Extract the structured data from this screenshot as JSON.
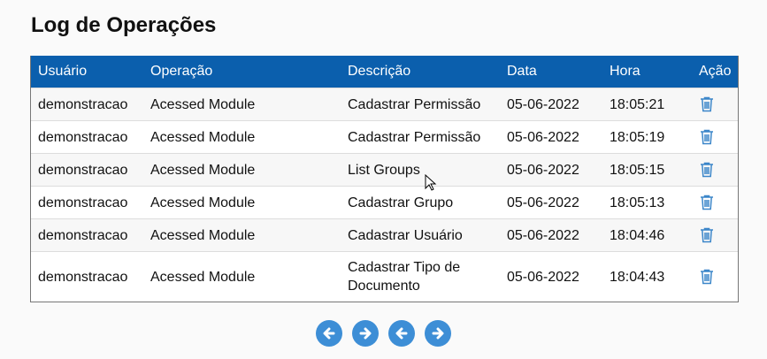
{
  "title": "Log de Operações",
  "columns": {
    "user": "Usuário",
    "operation": "Operação",
    "description": "Descrição",
    "date": "Data",
    "time": "Hora",
    "action": "Ação"
  },
  "rows": [
    {
      "user": "demonstracao",
      "operation": "Acessed Module",
      "description": "Cadastrar Permissão",
      "date": "05-06-2022",
      "time": "18:05:21",
      "action_icon": "trash-icon"
    },
    {
      "user": "demonstracao",
      "operation": "Acessed Module",
      "description": "Cadastrar Permissão",
      "date": "05-06-2022",
      "time": "18:05:19",
      "action_icon": "trash-icon"
    },
    {
      "user": "demonstracao",
      "operation": "Acessed Module",
      "description": "List Groups",
      "date": "05-06-2022",
      "time": "18:05:15",
      "action_icon": "trash-icon"
    },
    {
      "user": "demonstracao",
      "operation": "Acessed Module",
      "description": "Cadastrar Grupo",
      "date": "05-06-2022",
      "time": "18:05:13",
      "action_icon": "trash-icon"
    },
    {
      "user": "demonstracao",
      "operation": "Acessed Module",
      "description": "Cadastrar Usuário",
      "date": "05-06-2022",
      "time": "18:04:46",
      "action_icon": "trash-icon"
    },
    {
      "user": "demonstracao",
      "operation": "Acessed Module",
      "description": "Cadastrar Tipo de Documento",
      "date": "05-06-2022",
      "time": "18:04:43",
      "action_icon": "trash-icon"
    }
  ],
  "pagination": {
    "buttons": [
      "first-page-icon",
      "next-page-icon",
      "previous-page-icon",
      "last-page-icon"
    ]
  },
  "colors": {
    "header_bg": "#0b5fad",
    "icon_blue": "#3d8ed6",
    "trash": "#3b86c9"
  }
}
